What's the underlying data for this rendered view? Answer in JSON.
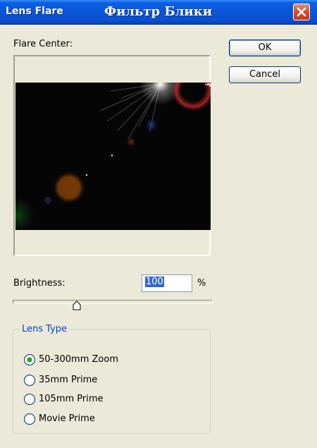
{
  "window": {
    "title": "Lens Flare",
    "overlay_caption": "Фильтр Блики",
    "close_icon": "close-x-icon",
    "accent": "#0a55d8",
    "close_color": "#d6492b"
  },
  "preview": {
    "label": "Flare Center:"
  },
  "buttons": {
    "ok": "OK",
    "cancel": "Cancel"
  },
  "brightness": {
    "label": "Brightness:",
    "value": "100",
    "unit": "%",
    "slider_fraction": 0.32
  },
  "lens_type": {
    "title": "Lens Type",
    "options": [
      {
        "label": "50-300mm Zoom",
        "selected": true
      },
      {
        "label": "35mm Prime",
        "selected": false
      },
      {
        "label": "105mm Prime",
        "selected": false
      },
      {
        "label": "Movie Prime",
        "selected": false
      }
    ]
  }
}
